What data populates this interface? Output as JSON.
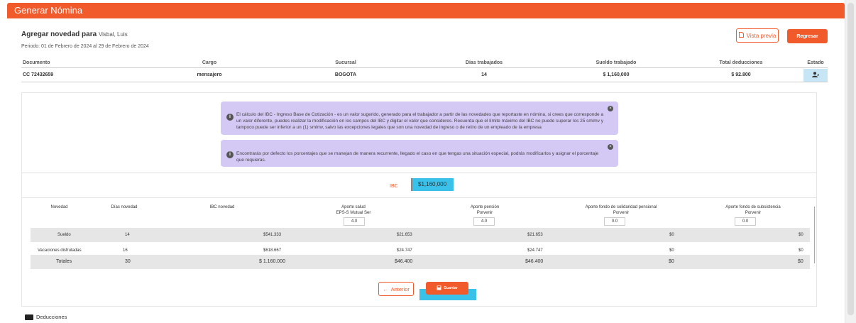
{
  "header": {
    "title": "Generar Nómina"
  },
  "page": {
    "title_prefix": "Agregar novedad para",
    "employee": "Visbal, Luis",
    "period": "Periodo: 01 de Febrero de 2024 al 29 de Febrero de 2024",
    "preview_label": "Vista previa",
    "back_label": "Regresar"
  },
  "summary": {
    "columns": [
      "Documento",
      "Cargo",
      "Sucursal",
      "Días trabajados",
      "Sueldo trabajado",
      "Total deducciones",
      "Estado"
    ],
    "row": {
      "documento": "CC 72432659",
      "cargo": "mensajero",
      "sucursal": "BOGOTA",
      "dias": "14",
      "sueldo": "$ 1,160,000",
      "deducciones": "$ 92.800"
    }
  },
  "alerts": [
    "El cálculo del IBC - Ingreso Base de Cotización - es un valor sugerido, generado para el trabajador a partir de las novedades que reportaste en nómina, si crees que corresponde a un valor diferente, puedes realizar la modificación en los campos del IBC y digitar el valor que consideres. Recuerda que el límite máximo del IBC no puede superar los 25 smlmv y tampoco puede ser inferior a un (1) smlmv, salvo las excepciones legales que son una novedad de ingreso o de retiro de un empleado de la empresa",
    "Encontrarás por defecto los porcentajes que se manejan de manera recurrente, llegado el caso en que tengas una situación especial, podrás modificarlos y asignar el porcentaje que requieras."
  ],
  "ibc": {
    "label": "IBC",
    "value": "$1,160,000"
  },
  "novedades": {
    "headers": {
      "novedad": "Novedad",
      "dias": "Días novedad",
      "ibc": "IBC novedad",
      "salud": "Aporte salud",
      "salud_entity": "EPS-S Mutual Ser",
      "salud_pct": "4.0",
      "pension": "Aporte pensión",
      "pension_entity": "Porvenir",
      "pension_pct": "4.0",
      "solidaridad": "Aporte fondo de solidaridad pensional",
      "solidaridad_entity": "Porvenir",
      "solidaridad_pct": "0.0",
      "subsistencia": "Aporte fondo de subsistencia",
      "subsistencia_entity": "Porvenir",
      "subsistencia_pct": "0.0"
    },
    "rows": [
      {
        "novedad": "Sueldo",
        "dias": "14",
        "ibc": "$541.333",
        "salud": "$21.653",
        "pension": "$21.653",
        "solidaridad": "$0",
        "subsistencia": "$0"
      },
      {
        "novedad": "Vacaciones disfrutadas",
        "dias": "16",
        "ibc": "$618.667",
        "salud": "$24.747",
        "pension": "$24.747",
        "solidaridad": "$0",
        "subsistencia": "$0"
      }
    ],
    "totals": {
      "label": "Totales",
      "dias": "30",
      "ibc": "$ 1.160.000",
      "salud": "$46.400",
      "pension": "$46.400",
      "solidaridad": "$0",
      "subsistencia": "$0"
    }
  },
  "actions": {
    "prev_label": "Anterior",
    "save_label": "Guardar"
  },
  "footer": {
    "deducciones_label": "Deducciones"
  },
  "colors": {
    "accent": "#f15a2b",
    "highlight": "#39c1ea",
    "alert_bg": "#d4c8f5"
  }
}
